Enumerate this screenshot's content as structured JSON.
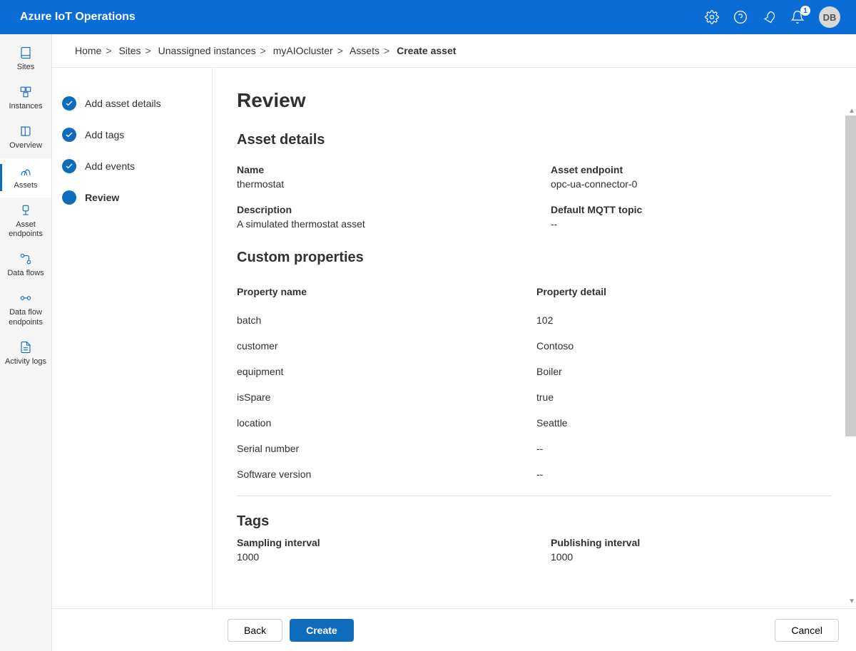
{
  "app_title": "Azure IoT Operations",
  "notification_count": "1",
  "avatar_initials": "DB",
  "breadcrumbs": [
    "Home",
    "Sites",
    "Unassigned instances",
    "myAIOcluster",
    "Assets"
  ],
  "breadcrumb_current": "Create asset",
  "nav": [
    {
      "label": "Sites"
    },
    {
      "label": "Instances"
    },
    {
      "label": "Overview"
    },
    {
      "label": "Assets"
    },
    {
      "label": "Asset endpoints"
    },
    {
      "label": "Data flows"
    },
    {
      "label": "Data flow endpoints"
    },
    {
      "label": "Activity logs"
    }
  ],
  "steps": {
    "s1": "Add asset details",
    "s2": "Add tags",
    "s3": "Add events",
    "s4": "Review"
  },
  "page_title": "Review",
  "asset_details": {
    "heading": "Asset details",
    "name_label": "Name",
    "name_value": "thermostat",
    "endpoint_label": "Asset endpoint",
    "endpoint_value": "opc-ua-connector-0",
    "desc_label": "Description",
    "desc_value": "A simulated thermostat asset",
    "mqtt_label": "Default MQTT topic",
    "mqtt_value": "--"
  },
  "custom_props": {
    "heading": "Custom properties",
    "col1": "Property name",
    "col2": "Property detail",
    "rows": [
      {
        "name": "batch",
        "detail": "102"
      },
      {
        "name": "customer",
        "detail": "Contoso"
      },
      {
        "name": "equipment",
        "detail": "Boiler"
      },
      {
        "name": "isSpare",
        "detail": "true"
      },
      {
        "name": "location",
        "detail": "Seattle"
      },
      {
        "name": "Serial number",
        "detail": "--"
      },
      {
        "name": "Software version",
        "detail": "--"
      }
    ]
  },
  "tags": {
    "heading": "Tags",
    "sampling_label": "Sampling interval",
    "sampling_value": "1000",
    "publishing_label": "Publishing interval",
    "publishing_value": "1000"
  },
  "buttons": {
    "back": "Back",
    "create": "Create",
    "cancel": "Cancel"
  }
}
